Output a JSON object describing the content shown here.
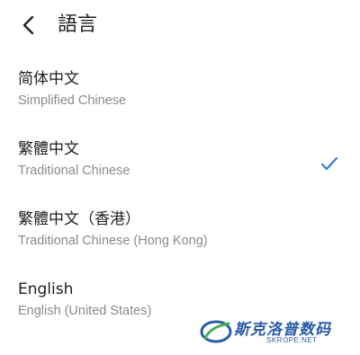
{
  "header": {
    "title": "語言"
  },
  "languages": [
    {
      "primary": "简体中文",
      "secondary": "Simplified Chinese",
      "selected": false
    },
    {
      "primary": "繁體中文",
      "secondary": "Traditional Chinese",
      "selected": true
    },
    {
      "primary": "繁體中文（香港）",
      "secondary": "Traditional Chinese (Hong Kong)",
      "selected": false
    },
    {
      "primary": "English",
      "secondary": "English (United States)",
      "selected": false
    }
  ],
  "watermark": {
    "text": "斯克洛普数码",
    "subtext": "SKROPE.NET"
  },
  "colors": {
    "accent": "#3b78d8",
    "secondary_text": "#8a8a8a",
    "primary_text": "#202020"
  },
  "icons": {
    "back": "chevron-left-icon",
    "selected": "checkmark-icon"
  }
}
